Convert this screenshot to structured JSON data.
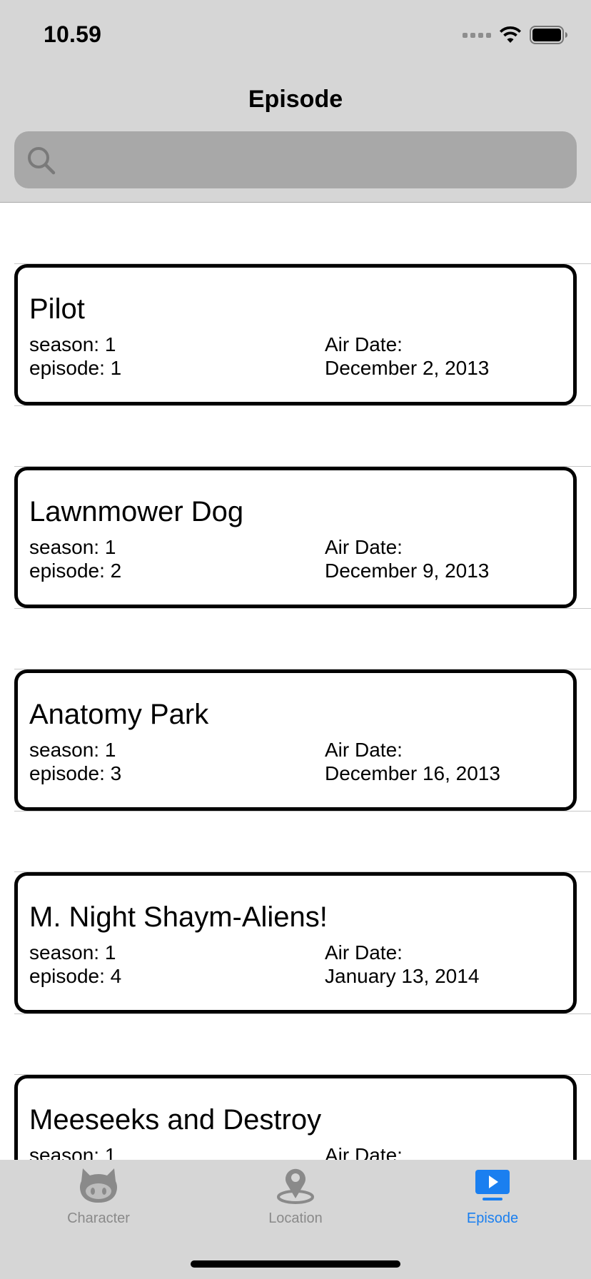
{
  "status_bar": {
    "time": "10.59"
  },
  "navigation": {
    "title": "Episode"
  },
  "search": {
    "placeholder": "",
    "value": ""
  },
  "labels": {
    "season_prefix": "season: ",
    "episode_prefix": "episode: ",
    "air_date_label": "Air Date:"
  },
  "episodes": [
    {
      "title": "Pilot",
      "season": "season: 1",
      "episode": "episode: 1",
      "air_date_label": "Air Date:",
      "air_date": "December 2, 2013"
    },
    {
      "title": "Lawnmower Dog",
      "season": "season: 1",
      "episode": "episode: 2",
      "air_date_label": "Air Date:",
      "air_date": "December 9, 2013"
    },
    {
      "title": "Anatomy Park",
      "season": "season: 1",
      "episode": "episode: 3",
      "air_date_label": "Air Date:",
      "air_date": "December 16, 2013"
    },
    {
      "title": "M. Night Shaym-Aliens!",
      "season": "season: 1",
      "episode": "episode: 4",
      "air_date_label": "Air Date:",
      "air_date": "January 13, 2014"
    },
    {
      "title": "Meeseeks and Destroy",
      "season": "season: 1",
      "episode": "",
      "air_date_label": "Air Date:",
      "air_date": ""
    }
  ],
  "tab_bar": {
    "tabs": [
      {
        "label": "Character",
        "icon": "github-octocat-icon",
        "selected": false
      },
      {
        "label": "Location",
        "icon": "location-pin-icon",
        "selected": false
      },
      {
        "label": "Episode",
        "icon": "play-tv-icon",
        "selected": true
      }
    ],
    "active_color": "#1a7ff0",
    "inactive_color": "#8a8a8a"
  }
}
